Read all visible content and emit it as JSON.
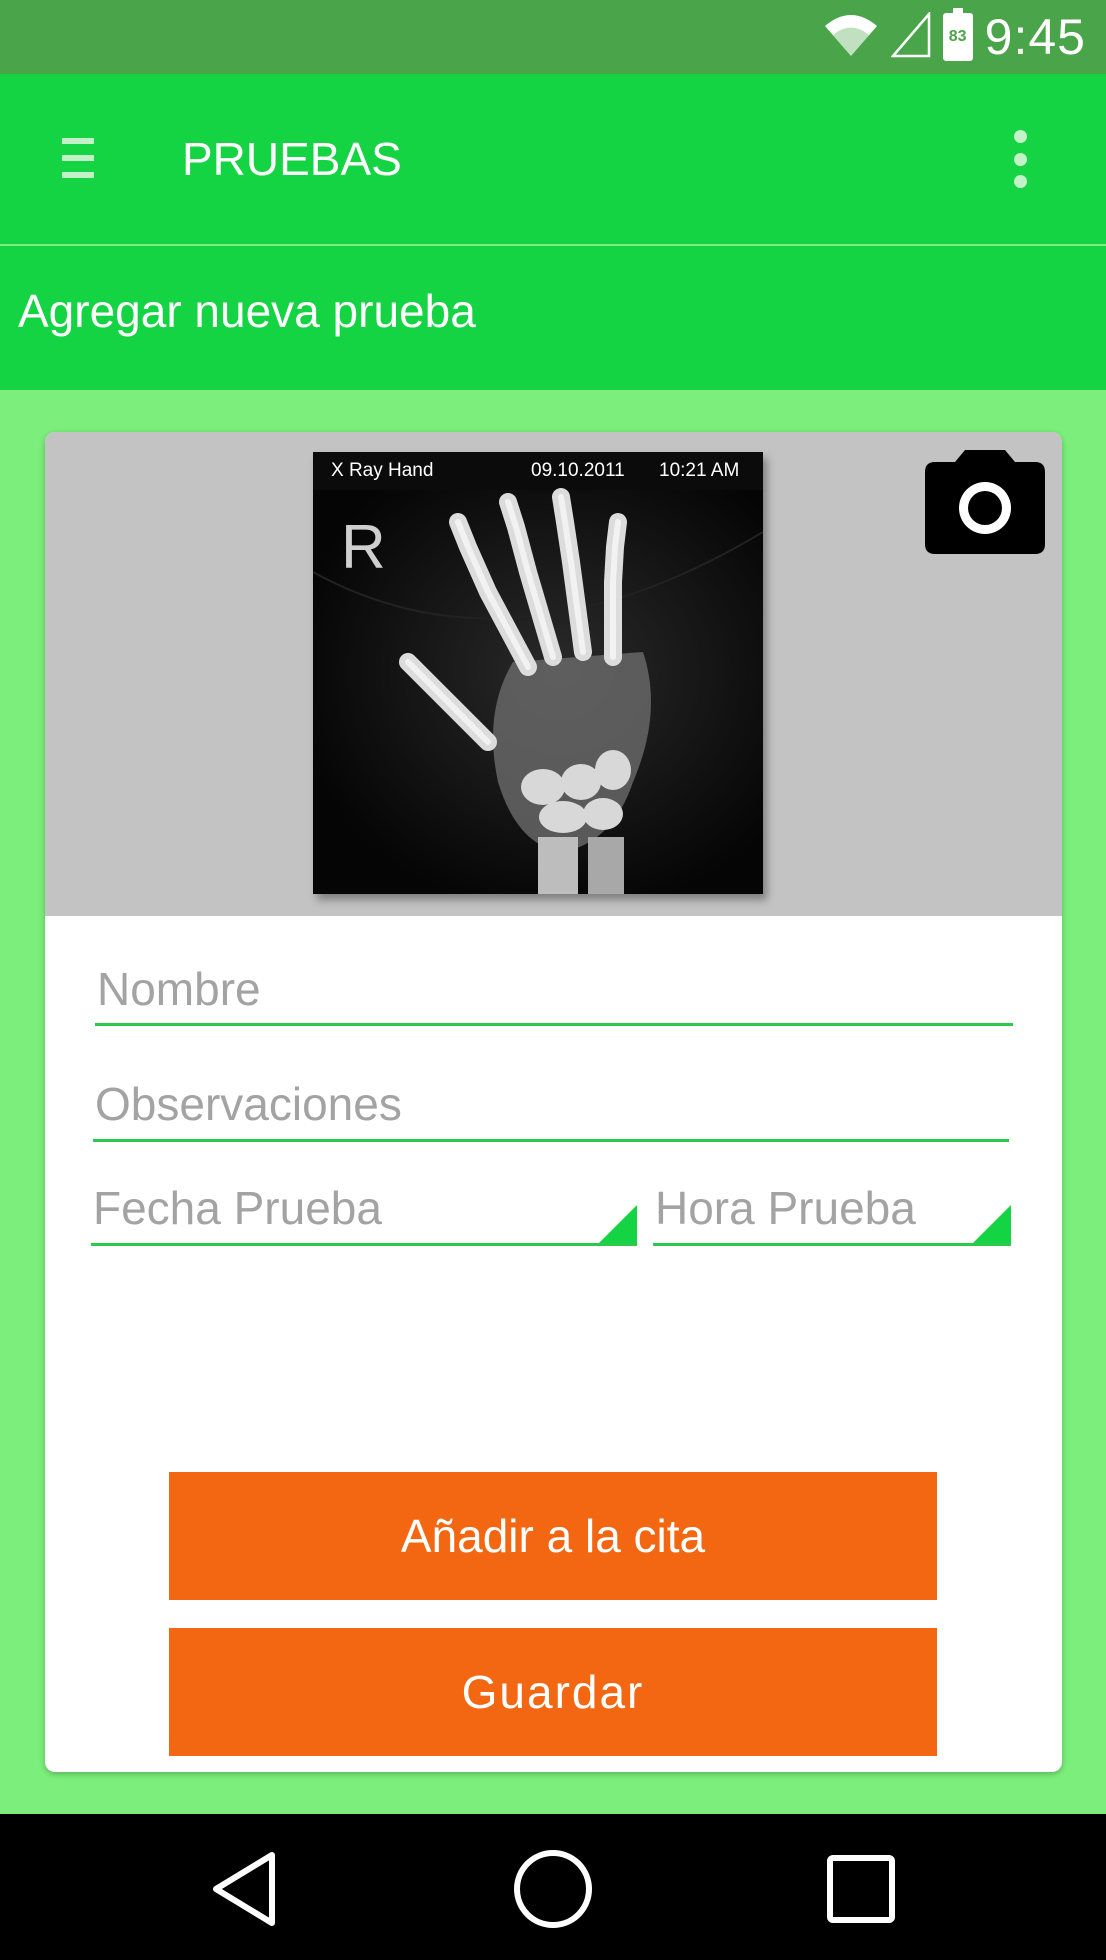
{
  "status_bar": {
    "time": "9:45",
    "battery_level": "83",
    "icons": [
      "wifi-icon",
      "signal-icon",
      "battery-icon"
    ]
  },
  "app_bar": {
    "title": "PRUEBAS",
    "menu_icon": "hamburger-menu-icon",
    "overflow_icon": "more-vert-icon"
  },
  "subheader": {
    "title": "Agregar nueva prueba"
  },
  "test_image": {
    "type_label": "X Ray  Hand",
    "date": "09.10.2011",
    "time": "10:21 AM",
    "side": "R",
    "camera_icon": "camera-icon"
  },
  "form": {
    "name_placeholder": "Nombre",
    "name_value": "",
    "observations_placeholder": "Observaciones",
    "observations_value": "",
    "date_placeholder": "Fecha Prueba",
    "date_value": "",
    "time_placeholder": "Hora Prueba",
    "time_value": ""
  },
  "actions": {
    "add_to_appointment": "Añadir a la cita",
    "save": "Guardar"
  },
  "nav_bar": {
    "icons": [
      "back-icon",
      "home-icon",
      "recents-icon"
    ]
  },
  "colors": {
    "status_bar": "#4aa54a",
    "app_bar": "#14d443",
    "background": "#7bee7b",
    "button": "#f46712",
    "field_underline": "#2dc94b"
  }
}
